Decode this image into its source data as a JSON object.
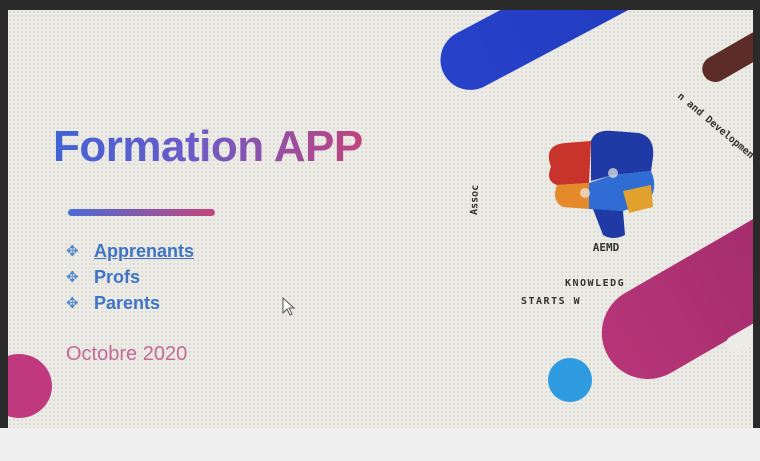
{
  "slide": {
    "title": "Formation APP",
    "bullets": [
      {
        "label": "Apprenants",
        "icon": "diamond-bullet-icon",
        "underlined": true
      },
      {
        "label": "Profs",
        "icon": "diamond-bullet-icon",
        "underlined": false
      },
      {
        "label": "Parents",
        "icon": "diamond-bullet-icon",
        "underlined": false
      }
    ],
    "date": "Octobre 2020"
  },
  "logo": {
    "name": "AEMD",
    "arc_left": "Assoc",
    "arc_right": "n and Development",
    "tagline_line1": "KNOWLEDG",
    "tagline_line2": "STARTS W",
    "icon": "brain-puzzle-icon"
  },
  "colors": {
    "title_start": "#3f63d6",
    "title_end": "#c0447e",
    "bullet": "#3f74c4",
    "date": "#c46a95",
    "blue_shape": "#2742c9",
    "pink_shape": "#b63578",
    "dot": "#2e9ae0"
  }
}
